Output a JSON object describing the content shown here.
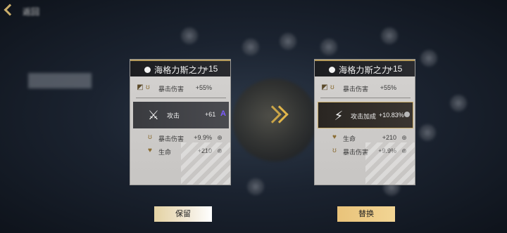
{
  "topbar": {
    "back_label": "返回"
  },
  "left_card": {
    "name": "海格力斯之力",
    "level": "+15",
    "rows": [
      {
        "label": "暴击伤害",
        "value": "+55%"
      },
      {
        "label": "暴击伤害",
        "value": "+9.9%"
      },
      {
        "label": "生命",
        "value": "+210"
      }
    ],
    "main": {
      "label": "攻击",
      "value": "+61",
      "rank": "A"
    }
  },
  "right_card": {
    "name": "海格力斯之力",
    "level": "+15",
    "rows": [
      {
        "label": "暴击伤害",
        "value": "+55%"
      },
      {
        "label": "生命",
        "value": "+210"
      },
      {
        "label": "暴击伤害",
        "value": "+9.9%"
      }
    ],
    "main": {
      "label": "攻击加成",
      "value": "+10.83%"
    }
  },
  "buttons": {
    "keep": "保留",
    "replace": "替换"
  },
  "colors": {
    "accent": "#e0b54a",
    "rank_a": "#7c5cff",
    "card_bg": "#cfcdcb"
  }
}
